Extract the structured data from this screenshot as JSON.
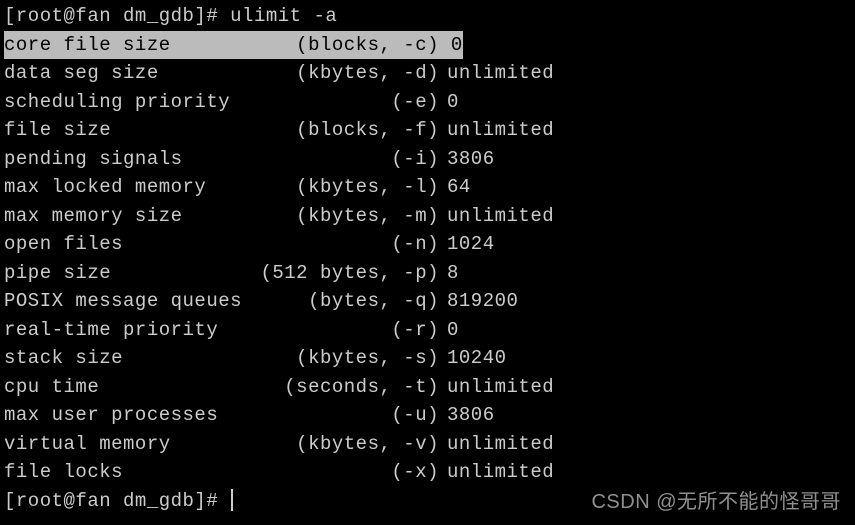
{
  "prompt": "[root@fan dm_gdb]# ",
  "command": "ulimit -a",
  "rows": [
    {
      "name": "core file size",
      "unit": "(blocks, -c)",
      "value": "0",
      "highlight": true
    },
    {
      "name": "data seg size",
      "unit": "(kbytes, -d)",
      "value": "unlimited"
    },
    {
      "name": "scheduling priority",
      "unit": "(-e)",
      "value": "0"
    },
    {
      "name": "file size",
      "unit": "(blocks, -f)",
      "value": "unlimited"
    },
    {
      "name": "pending signals",
      "unit": "(-i)",
      "value": "3806"
    },
    {
      "name": "max locked memory",
      "unit": "(kbytes, -l)",
      "value": "64"
    },
    {
      "name": "max memory size",
      "unit": "(kbytes, -m)",
      "value": "unlimited"
    },
    {
      "name": "open files",
      "unit": "(-n)",
      "value": "1024"
    },
    {
      "name": "pipe size",
      "unit": "(512 bytes, -p)",
      "value": "8"
    },
    {
      "name": "POSIX message queues",
      "unit": "(bytes, -q)",
      "value": "819200"
    },
    {
      "name": "real-time priority",
      "unit": "(-r)",
      "value": "0"
    },
    {
      "name": "stack size",
      "unit": "(kbytes, -s)",
      "value": "10240"
    },
    {
      "name": "cpu time",
      "unit": "(seconds, -t)",
      "value": "unlimited"
    },
    {
      "name": "max user processes",
      "unit": "(-u)",
      "value": "3806"
    },
    {
      "name": "virtual memory",
      "unit": "(kbytes, -v)",
      "value": "unlimited"
    },
    {
      "name": "file locks",
      "unit": "(-x)",
      "value": "unlimited"
    }
  ],
  "watermark": "CSDN @无所不能的怪哥哥"
}
